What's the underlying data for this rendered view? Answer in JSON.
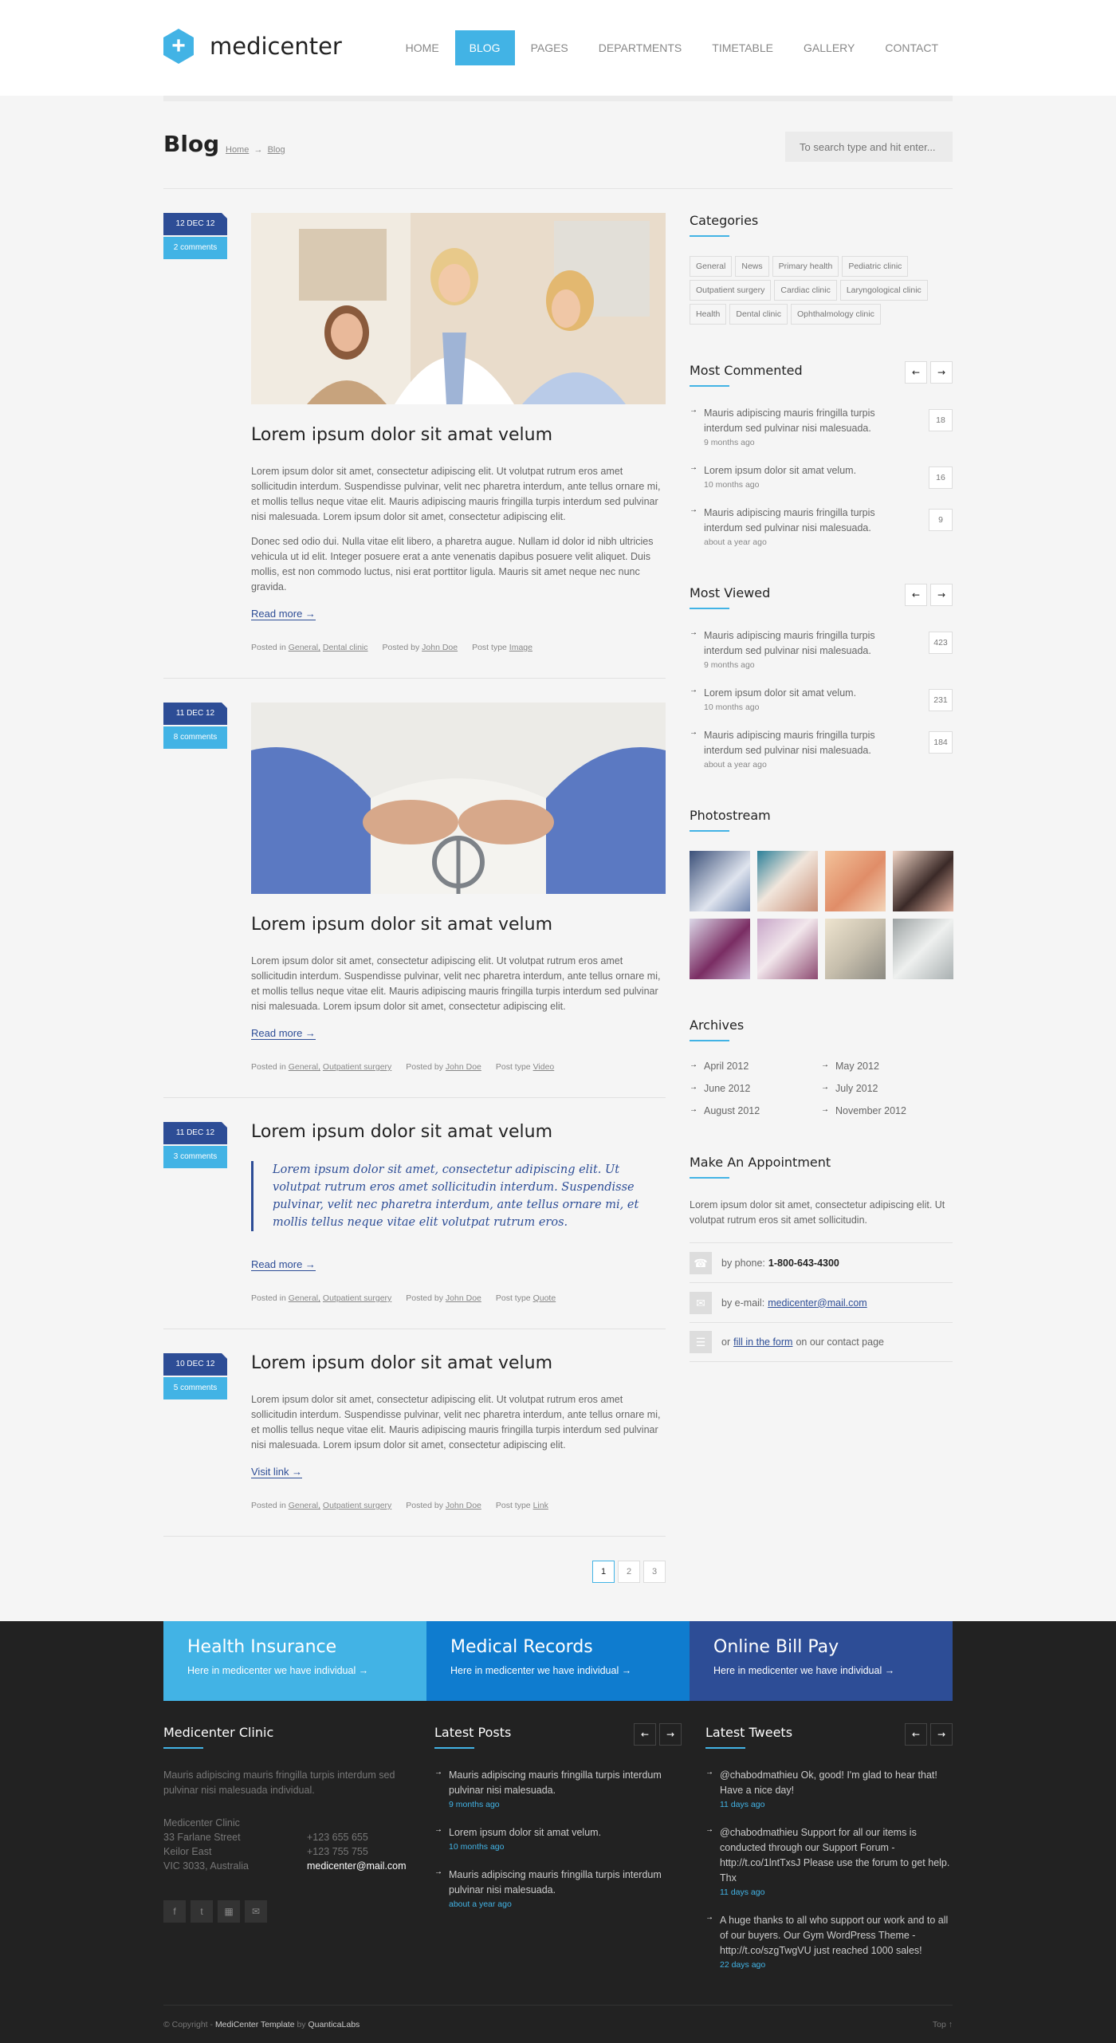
{
  "brand": {
    "name": "medicenter"
  },
  "nav": [
    "HOME",
    "BLOG",
    "PAGES",
    "DEPARTMENTS",
    "TIMETABLE",
    "GALLERY",
    "CONTACT"
  ],
  "page": {
    "title": "Blog",
    "crumb_home": "Home",
    "crumb_current": "Blog",
    "search_placeholder": "To search type and hit enter..."
  },
  "posts": [
    {
      "date": "12 DEC 12",
      "comments": "2 comments",
      "title": "Lorem ipsum dolor sit amat velum",
      "p1": "Lorem ipsum dolor sit amet, consectetur adipiscing elit. Ut volutpat rutrum eros amet sollicitudin interdum. Suspendisse pulvinar, velit nec pharetra interdum, ante tellus ornare mi, et mollis tellus neque vitae elit. Mauris adipiscing mauris fringilla turpis interdum sed pulvinar nisi malesuada. Lorem ipsum dolor sit amet, consectetur adipiscing elit.",
      "p2": "Donec sed odio dui. Nulla vitae elit libero, a pharetra augue. Nullam id dolor id nibh ultricies vehicula ut id elit. Integer posuere erat a ante venenatis dapibus posuere velit aliquet. Duis mollis, est non commodo luctus, nisi erat porttitor ligula. Mauris sit amet neque nec nunc gravida.",
      "more": "Read more →",
      "posted_in": "Posted in",
      "cat1": "General,",
      "cat2": "Dental clinic",
      "posted_by": "Posted by",
      "author": "John Doe",
      "post_type": "Post type",
      "type": "Image"
    },
    {
      "date": "11 DEC 12",
      "comments": "8 comments",
      "title": "Lorem ipsum dolor sit amat velum",
      "p1": "Lorem ipsum dolor sit amet, consectetur adipiscing elit. Ut volutpat rutrum eros amet sollicitudin interdum. Suspendisse pulvinar, velit nec pharetra interdum, ante tellus ornare mi, et mollis tellus neque vitae elit. Mauris adipiscing mauris fringilla turpis interdum sed pulvinar nisi malesuada. Lorem ipsum dolor sit amet, consectetur adipiscing elit.",
      "more": "Read more →",
      "posted_in": "Posted in",
      "cat1": "General,",
      "cat2": "Outpatient surgery",
      "posted_by": "Posted by",
      "author": "John Doe",
      "post_type": "Post type",
      "type": "Video"
    },
    {
      "date": "11 DEC 12",
      "comments": "3 comments",
      "title": "Lorem ipsum dolor sit amat velum",
      "quote": "Lorem ipsum dolor sit amet, consectetur adipiscing elit. Ut volutpat rutrum eros amet sollicitudin interdum. Suspendisse pulvinar, velit nec pharetra interdum, ante tellus ornare mi, et mollis tellus neque vitae elit volutpat rutrum eros.",
      "more": "Read more →",
      "posted_in": "Posted in",
      "cat1": "General,",
      "cat2": "Outpatient surgery",
      "posted_by": "Posted by",
      "author": "John Doe",
      "post_type": "Post type",
      "type": "Quote"
    },
    {
      "date": "10 DEC 12",
      "comments": "5 comments",
      "title": "Lorem ipsum dolor sit amat velum",
      "p1": "Lorem ipsum dolor sit amet, consectetur adipiscing elit. Ut volutpat rutrum eros amet sollicitudin interdum. Suspendisse pulvinar, velit nec pharetra interdum, ante tellus ornare mi, et mollis tellus neque vitae elit. Mauris adipiscing mauris fringilla turpis interdum sed pulvinar nisi malesuada. Lorem ipsum dolor sit amet, consectetur adipiscing elit.",
      "more": "Visit link →",
      "posted_in": "Posted in",
      "cat1": "General,",
      "cat2": "Outpatient surgery",
      "posted_by": "Posted by",
      "author": "John Doe",
      "post_type": "Post type",
      "type": "Link"
    }
  ],
  "pager": [
    "1",
    "2",
    "3"
  ],
  "sidebar": {
    "categories_title": "Categories",
    "tags": [
      "General",
      "News",
      "Primary health",
      "Pediatric clinic",
      "Outpatient surgery",
      "Cardiac clinic",
      "Laryngological clinic",
      "Health",
      "Dental clinic",
      "Ophthalmology clinic"
    ],
    "most_commented_title": "Most Commented",
    "most_commented": [
      {
        "t": "Mauris adipiscing mauris fringilla turpis interdum sed pulvinar nisi malesuada.",
        "ago": "9 months ago",
        "c": "18"
      },
      {
        "t": "Lorem ipsum dolor sit amat velum.",
        "ago": "10 months ago",
        "c": "16"
      },
      {
        "t": "Mauris adipiscing mauris fringilla turpis interdum sed pulvinar nisi malesuada.",
        "ago": "about a year ago",
        "c": "9"
      }
    ],
    "most_viewed_title": "Most Viewed",
    "most_viewed": [
      {
        "t": "Mauris adipiscing mauris fringilla turpis interdum sed pulvinar nisi malesuada.",
        "ago": "9 months ago",
        "c": "423"
      },
      {
        "t": "Lorem ipsum dolor sit amat velum.",
        "ago": "10 months ago",
        "c": "231"
      },
      {
        "t": "Mauris adipiscing mauris fringilla turpis interdum sed pulvinar nisi malesuada.",
        "ago": "about a year ago",
        "c": "184"
      }
    ],
    "photostream_title": "Photostream",
    "archives_title": "Archives",
    "archives": [
      "April 2012",
      "May 2012",
      "June 2012",
      "July 2012",
      "August 2012",
      "November 2012"
    ],
    "appt_title": "Make An Appointment",
    "appt_text": "Lorem ipsum dolor sit amet, consectetur adipiscing elit. Ut volutpat rutrum eros sit amet sollicitudin.",
    "phone_label": "by phone:",
    "phone": "1-800-643-4300",
    "email_label": "by e-mail:",
    "email": "medicenter@mail.com",
    "form_pre": "or",
    "form_link": "fill in the form",
    "form_post": "on our contact page",
    "prev": "←",
    "next": "→"
  },
  "footer": {
    "boxes": [
      {
        "title": "Health Insurance",
        "text": "Here in medicenter we have individual  →",
        "color": "#42b3e5"
      },
      {
        "title": "Medical Records",
        "text": "Here in medicenter we have individual  →",
        "color": "#0f7ccf"
      },
      {
        "title": "Online Bill Pay",
        "text": "Here in medicenter we have individual  →",
        "color": "#2d4d96"
      }
    ],
    "clinic_title": "Medicenter Clinic",
    "clinic_text": "Mauris adipiscing mauris fringilla turpis interdum sed pulvinar nisi malesuada individual.",
    "addr_left": [
      "Medicenter Clinic",
      "33 Farlane Street",
      "Keilor East",
      "VIC 3033, Australia"
    ],
    "addr_right": [
      "",
      "+123 655 655",
      "+123 755 755",
      "medicenter@mail.com"
    ],
    "posts_title": "Latest Posts",
    "posts": [
      {
        "t": "Mauris adipiscing mauris fringilla turpis interdum pulvinar nisi malesuada.",
        "ago": "9 months ago"
      },
      {
        "t": "Lorem ipsum dolor sit amat velum.",
        "ago": "10 months ago"
      },
      {
        "t": "Mauris adipiscing mauris fringilla turpis interdum pulvinar nisi malesuada.",
        "ago": "about a year ago"
      }
    ],
    "tweets_title": "Latest Tweets",
    "tweets": [
      {
        "t": "@chabodmathieu Ok, good! I'm glad to hear that! Have a nice day!",
        "link": "",
        "ago": "11 days ago"
      },
      {
        "t": "@chabodmathieu Support for all our items is conducted through our Support Forum - ",
        "link": "http://t.co/1lntTxsJ",
        "t2": " Please use the forum to get help. Thx",
        "ago": "11 days ago"
      },
      {
        "t": "A huge thanks to all who support our work and to all of our buyers. Our Gym WordPress Theme - ",
        "link": "http://t.co/szgTwgVU",
        "t2": " just reached 1000 sales!",
        "ago": "22 days ago"
      }
    ],
    "copy_pre": "© Copyright - ",
    "copy_name": "MediCenter Template",
    "copy_by": " by ",
    "copy_company": "QuanticaLabs",
    "top": "Top  ↑"
  }
}
